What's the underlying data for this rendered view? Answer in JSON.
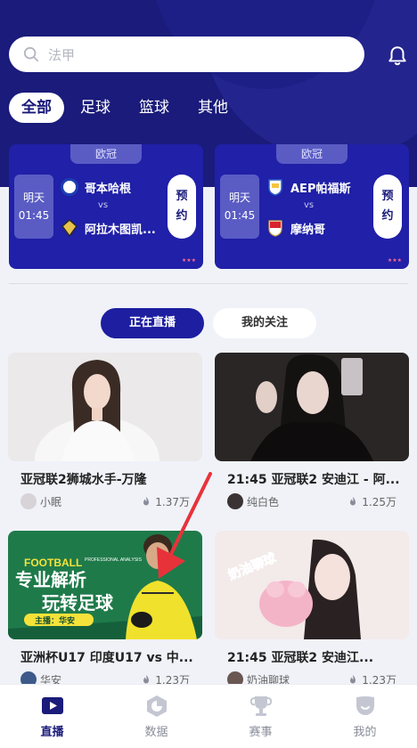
{
  "search": {
    "placeholder": "法甲"
  },
  "tabs": [
    {
      "label": "全部"
    },
    {
      "label": "足球"
    },
    {
      "label": "篮球"
    },
    {
      "label": "其他"
    }
  ],
  "matches": [
    {
      "league": "欧冠",
      "day": "明天",
      "time": "01:45",
      "home": "哥本哈根",
      "away": "阿拉木图凯...",
      "vs": "vs",
      "book": [
        "预",
        "约"
      ]
    },
    {
      "league": "欧冠",
      "day": "明天",
      "time": "01:45",
      "home": "AEP帕福斯",
      "away": "摩纳哥",
      "vs": "vs",
      "book": [
        "预",
        "约"
      ]
    }
  ],
  "subtabs": {
    "live": "正在直播",
    "follow": "我的关注"
  },
  "streams": [
    {
      "title": "亚冠联2狮城水手-万隆",
      "streamer": "小眠",
      "viewers": "1.37万"
    },
    {
      "title": "21:45 亚冠联2 安迪江 - 阿...",
      "streamer": "纯白色",
      "viewers": "1.25万"
    },
    {
      "title": "亚洲杯U17  印度U17 vs 中...",
      "streamer": "华安",
      "viewers": "1.23万",
      "poster": {
        "l1": "FOOTBALL",
        "l2": "PROFESSIONAL ANALYSIS",
        "l3": "专业解析",
        "l4": "玩转足球",
        "l5": "主播：华安"
      }
    },
    {
      "title": "21:45    亚冠联2    安迪江...",
      "streamer": "奶油聊球",
      "viewers": "1.23万",
      "sticker": "奶油聊球"
    }
  ],
  "nav": [
    {
      "label": "直播"
    },
    {
      "label": "数据"
    },
    {
      "label": "赛事"
    },
    {
      "label": "我的"
    }
  ]
}
